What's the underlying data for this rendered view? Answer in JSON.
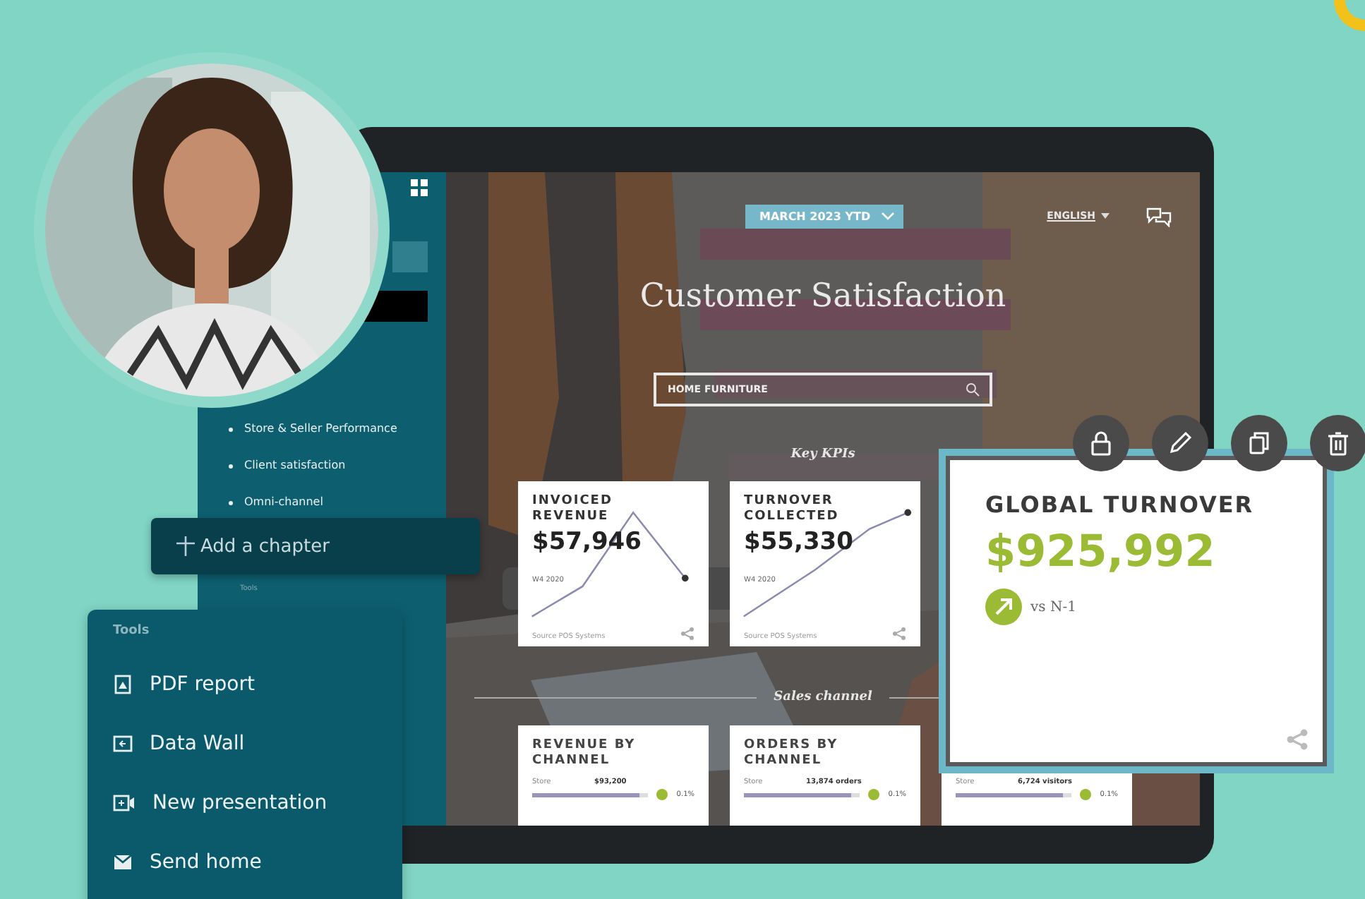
{
  "screen": {
    "period": "MARCH 2023 YTD",
    "language": "ENGLISH",
    "title": "Customer Satisfaction",
    "search": {
      "value": "HOME FURNITURE"
    },
    "kpi_section": "Key KPIs",
    "kpi_cards": [
      {
        "title": "INVOICED REVENUE",
        "value": "$57,946",
        "period": "W4 2020",
        "source": "Source POS Systems",
        "kind": "peak"
      },
      {
        "title": "TURNOVER COLLECTED",
        "value": "$55,330",
        "period": "W4 2020",
        "source": "Source POS Systems",
        "kind": "rise"
      }
    ],
    "channel_section": "Sales channel",
    "channel_cards": [
      {
        "title": "REVENUE BY CHANNEL",
        "row": {
          "label": "Store",
          "value": "$93,200",
          "level": 0.92,
          "change": "0.1%"
        }
      },
      {
        "title": "ORDERS BY CHANNEL",
        "row": {
          "label": "Store",
          "value": "13,874 orders",
          "level": 0.92,
          "change": "0.1%"
        }
      },
      {
        "row": {
          "label": "Store",
          "value": "6,724 visitors",
          "level": 0.92,
          "change": "0.1%"
        }
      }
    ]
  },
  "sidebar": {
    "items": [
      "Store & Seller Performance",
      "Client satisfaction",
      "Omni-channel"
    ],
    "tools_heading": "Tools"
  },
  "add_chapter": "Add a chapter",
  "tools_menu": {
    "title": "Tools",
    "items": [
      {
        "kind": "pdf",
        "label": "PDF report"
      },
      {
        "kind": "wall",
        "label": "Data Wall"
      },
      {
        "kind": "presentation",
        "label": "New presentation"
      },
      {
        "kind": "send",
        "label": "Send home"
      }
    ]
  },
  "global_card": {
    "title": "GLOBAL TURNOVER",
    "value": "$925,992",
    "kind": "up",
    "comparison": "vs N-1"
  }
}
